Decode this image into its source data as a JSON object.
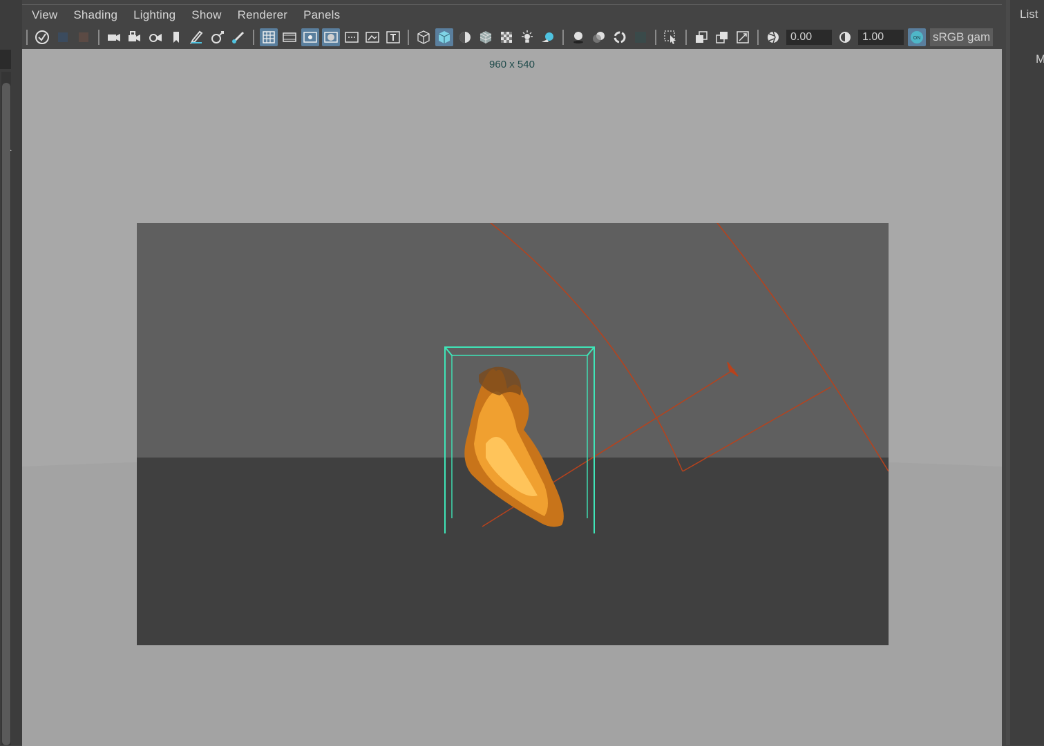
{
  "menubar": {
    "items": [
      "View",
      "Shading",
      "Lighting",
      "Show",
      "Renderer",
      "Panels"
    ]
  },
  "toolbar": {
    "exposure_value": "0.00",
    "gamma_value": "1.00",
    "color_space": "sRGB gam"
  },
  "viewport": {
    "resolution": "960 x 540"
  },
  "right_panel": {
    "title": "List",
    "letter": "M"
  },
  "colors": {
    "accent": "#5a7f9e",
    "bounding_box": "#3fe6b8",
    "emitter": "#b8421c",
    "fire": "#f09a22"
  },
  "icons": {
    "group1": [
      "select-camera-icon",
      "camera-attr-icon",
      "bookmark-icon"
    ],
    "group2": [
      "camera-icon",
      "camera-lock-icon",
      "camera-aim-icon",
      "bookmark-icon",
      "grease-pencil-icon",
      "dolly-icon",
      "paint-icon"
    ],
    "group3": [
      "grid-icon",
      "film-gate-icon",
      "resolution-gate-icon",
      "gate-mask-icon",
      "field-chart-icon",
      "safe-action-icon",
      "safe-title-icon"
    ],
    "group4": [
      "wireframe-icon",
      "smooth-shade-icon",
      "default-material-icon",
      "wireframe-on-shaded-icon",
      "textured-icon",
      "lights-icon",
      "shadows-icon"
    ],
    "group5": [
      "ambient-occlusion-icon",
      "motion-blur-icon",
      "antialias-icon",
      "depth-of-field-icon"
    ],
    "group6": [
      "isolate-select-icon"
    ],
    "group7": [
      "xray-icon",
      "xray-joints-icon",
      "xray-active-icon"
    ],
    "group8": [
      "exposure-icon",
      "gamma-icon",
      "color-management-icon"
    ]
  }
}
